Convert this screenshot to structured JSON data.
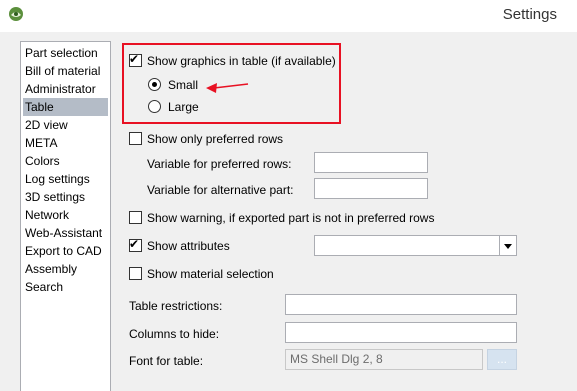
{
  "window": {
    "title": "Settings",
    "icon": "app-logo-icon"
  },
  "nav": {
    "items": [
      {
        "label": "Part selection",
        "selected": false
      },
      {
        "label": "Bill of material",
        "selected": false
      },
      {
        "label": "Administrator",
        "selected": false
      },
      {
        "label": "Table",
        "selected": true
      },
      {
        "label": "2D view",
        "selected": false
      },
      {
        "label": "META",
        "selected": false
      },
      {
        "label": "Colors",
        "selected": false
      },
      {
        "label": "Log settings",
        "selected": false
      },
      {
        "label": "3D settings",
        "selected": false
      },
      {
        "label": "Network",
        "selected": false
      },
      {
        "label": "Web-Assistant",
        "selected": false
      },
      {
        "label": "Export to CAD",
        "selected": false
      },
      {
        "label": "Assembly",
        "selected": false
      },
      {
        "label": "Search",
        "selected": false
      }
    ]
  },
  "table_settings": {
    "show_graphics": {
      "label": "Show graphics in table (if available)",
      "checked": true
    },
    "size_small": {
      "label": "Small",
      "selected": true
    },
    "size_large": {
      "label": "Large",
      "selected": false
    },
    "preferred_rows": {
      "label": "Show only preferred rows",
      "checked": false
    },
    "var_preferred": {
      "label": "Variable for preferred rows:",
      "value": ""
    },
    "var_alternative": {
      "label": "Variable for alternative part:",
      "value": ""
    },
    "warning": {
      "label": "Show warning, if exported part is not in preferred rows",
      "checked": false
    },
    "attributes": {
      "label": "Show attributes",
      "checked": true,
      "value": ""
    },
    "material": {
      "label": "Show material selection",
      "checked": false
    },
    "restrictions": {
      "label": "Table restrictions:",
      "value": ""
    },
    "columns_hide": {
      "label": "Columns to hide:",
      "value": ""
    },
    "font": {
      "label": "Font for table:",
      "value": "MS Shell Dlg 2, 8",
      "button": "..."
    }
  },
  "annotation": {
    "highlight_color": "#e81123"
  }
}
